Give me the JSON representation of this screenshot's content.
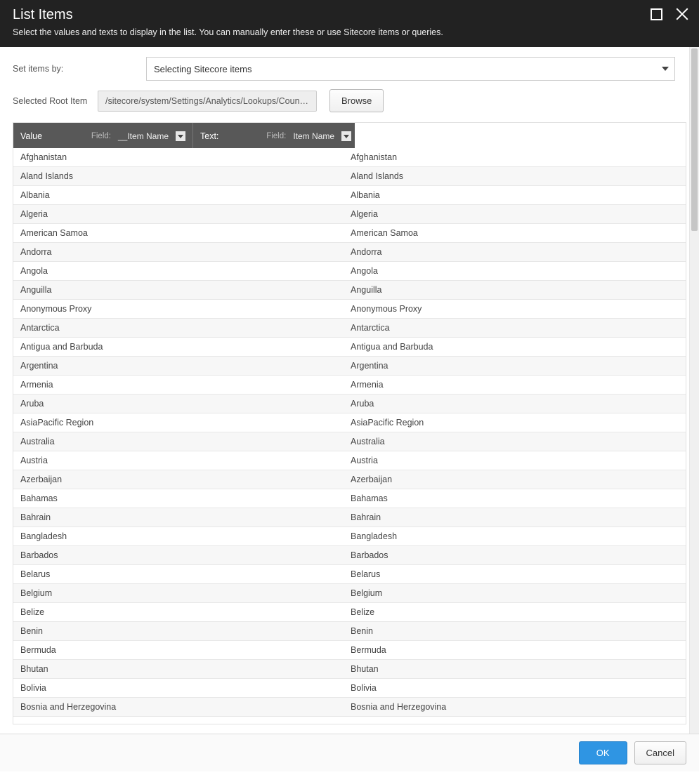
{
  "header": {
    "title": "List Items",
    "subtitle": "Select the values and texts to display in the list. You can manually enter these or use Sitecore items or queries."
  },
  "form": {
    "set_items_label": "Set items by:",
    "set_items_value": "Selecting Sitecore items",
    "root_label": "Selected Root Item",
    "root_path": "/sitecore/system/Settings/Analytics/Lookups/Countrie",
    "browse_label": "Browse"
  },
  "table": {
    "value_header": "Value",
    "text_header": "Text:",
    "field_label": "Field:",
    "value_field": "__Item Name",
    "text_field": "Item Name",
    "rows": [
      {
        "v": "Afghanistan",
        "t": "Afghanistan"
      },
      {
        "v": "Aland Islands",
        "t": "Aland Islands"
      },
      {
        "v": "Albania",
        "t": "Albania"
      },
      {
        "v": "Algeria",
        "t": "Algeria"
      },
      {
        "v": "American Samoa",
        "t": "American Samoa"
      },
      {
        "v": "Andorra",
        "t": "Andorra"
      },
      {
        "v": "Angola",
        "t": "Angola"
      },
      {
        "v": "Anguilla",
        "t": "Anguilla"
      },
      {
        "v": "Anonymous Proxy",
        "t": "Anonymous Proxy"
      },
      {
        "v": "Antarctica",
        "t": "Antarctica"
      },
      {
        "v": "Antigua and Barbuda",
        "t": "Antigua and Barbuda"
      },
      {
        "v": "Argentina",
        "t": "Argentina"
      },
      {
        "v": "Armenia",
        "t": "Armenia"
      },
      {
        "v": "Aruba",
        "t": "Aruba"
      },
      {
        "v": "AsiaPacific Region",
        "t": "AsiaPacific Region"
      },
      {
        "v": "Australia",
        "t": "Australia"
      },
      {
        "v": "Austria",
        "t": "Austria"
      },
      {
        "v": "Azerbaijan",
        "t": "Azerbaijan"
      },
      {
        "v": "Bahamas",
        "t": "Bahamas"
      },
      {
        "v": "Bahrain",
        "t": "Bahrain"
      },
      {
        "v": "Bangladesh",
        "t": "Bangladesh"
      },
      {
        "v": "Barbados",
        "t": "Barbados"
      },
      {
        "v": "Belarus",
        "t": "Belarus"
      },
      {
        "v": "Belgium",
        "t": "Belgium"
      },
      {
        "v": "Belize",
        "t": "Belize"
      },
      {
        "v": "Benin",
        "t": "Benin"
      },
      {
        "v": "Bermuda",
        "t": "Bermuda"
      },
      {
        "v": "Bhutan",
        "t": "Bhutan"
      },
      {
        "v": "Bolivia",
        "t": "Bolivia"
      },
      {
        "v": "Bosnia and Herzegovina",
        "t": "Bosnia and Herzegovina"
      }
    ]
  },
  "footer": {
    "ok": "OK",
    "cancel": "Cancel"
  }
}
